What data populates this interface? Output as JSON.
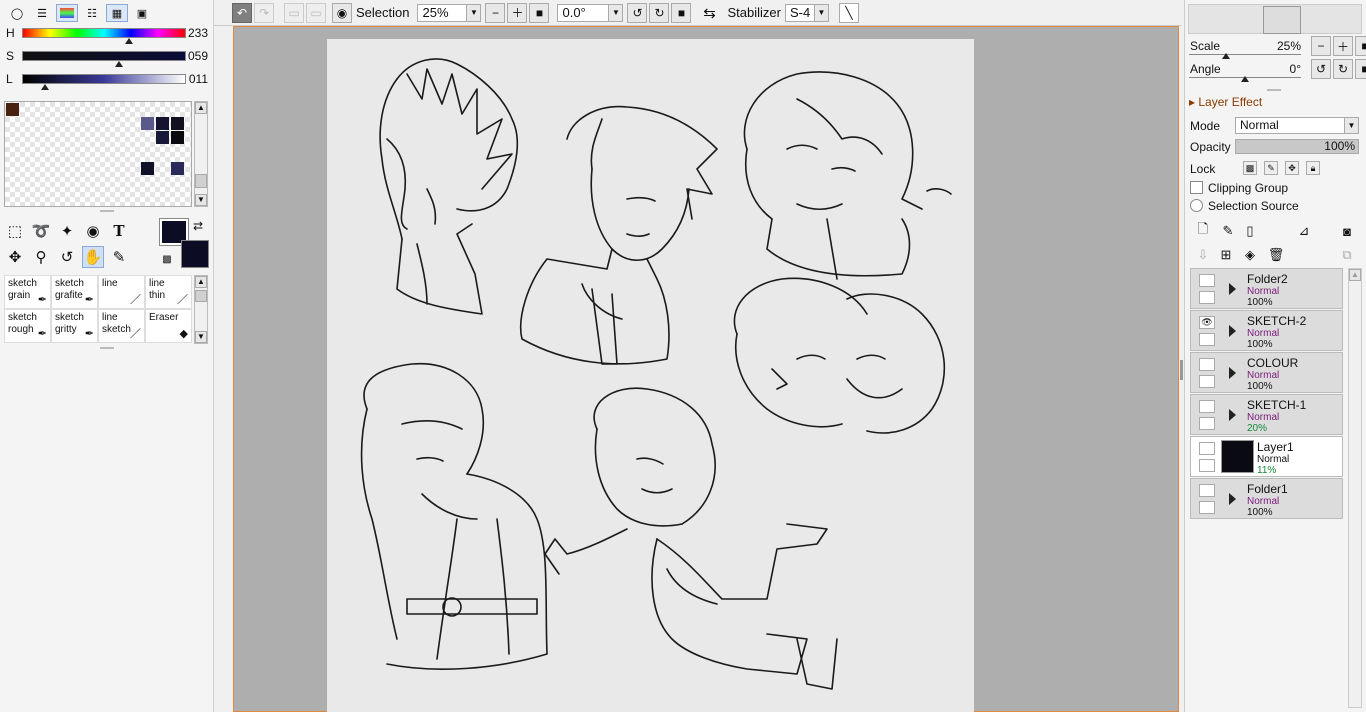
{
  "color": {
    "h": {
      "label": "H",
      "value": "233"
    },
    "s": {
      "label": "S",
      "value": "059"
    },
    "l": {
      "label": "L",
      "value": "011"
    },
    "current_hex": "#0c0c24",
    "swatches": [
      "#4a2010",
      "#5a5a8a",
      "#141430",
      "#101020",
      "#181838",
      "#0a0a10",
      "#101028",
      "#2a2a5a"
    ]
  },
  "tools": [
    "select-rect-icon",
    "lasso-icon",
    "magic-wand-icon",
    "bucket-icon",
    "text-icon",
    "move-icon",
    "zoom-icon",
    "rotate-icon",
    "hand-icon",
    "eyedropper-icon"
  ],
  "text_tool_glyph": "T",
  "brushes": [
    {
      "name1": "sketch",
      "name2": "grain"
    },
    {
      "name1": "sketch",
      "name2": "grafite"
    },
    {
      "name1": "line",
      "name2": ""
    },
    {
      "name1": "line",
      "name2": "thin"
    },
    {
      "name1": "sketch",
      "name2": "rough"
    },
    {
      "name1": "sketch",
      "name2": "gritty"
    },
    {
      "name1": "line",
      "name2": "sketch"
    },
    {
      "name1": "Eraser",
      "name2": ""
    }
  ],
  "toolbar": {
    "selection_label": "Selection",
    "zoom_value": "25%",
    "rotation_value": "0.0°",
    "stabilizer_label": "Stabilizer",
    "stabilizer_value": "S-4"
  },
  "navigator": {
    "scale_label": "Scale",
    "scale_value": "25%",
    "scale_fraction": 0.33,
    "angle_label": "Angle",
    "angle_value": "0°",
    "angle_fraction": 0.5
  },
  "layer_effect": {
    "title": "Layer Effect",
    "mode_label": "Mode",
    "mode_value": "Normal",
    "opacity_label": "Opacity",
    "opacity_value": "100%",
    "lock_label": "Lock",
    "clipping_label": "Clipping Group",
    "selection_source_label": "Selection Source"
  },
  "layers": [
    {
      "name": "Folder2",
      "mode": "Normal",
      "opacity": "100%",
      "type": "folder",
      "visible": false,
      "selected": false,
      "op_green": false
    },
    {
      "name": "SKETCH-2",
      "mode": "Normal",
      "opacity": "100%",
      "type": "folder",
      "visible": true,
      "selected": false,
      "op_green": false
    },
    {
      "name": "COLOUR",
      "mode": "Normal",
      "opacity": "100%",
      "type": "folder",
      "visible": false,
      "selected": false,
      "op_green": false
    },
    {
      "name": "SKETCH-1",
      "mode": "Normal",
      "opacity": "20%",
      "type": "folder",
      "visible": false,
      "selected": false,
      "op_green": true
    },
    {
      "name": "Layer1",
      "mode": "Normal",
      "opacity": "11%",
      "type": "layer",
      "visible": false,
      "selected": true,
      "op_green": true
    },
    {
      "name": "Folder1",
      "mode": "Normal",
      "opacity": "100%",
      "type": "folder",
      "visible": false,
      "selected": false,
      "op_green": false
    }
  ]
}
